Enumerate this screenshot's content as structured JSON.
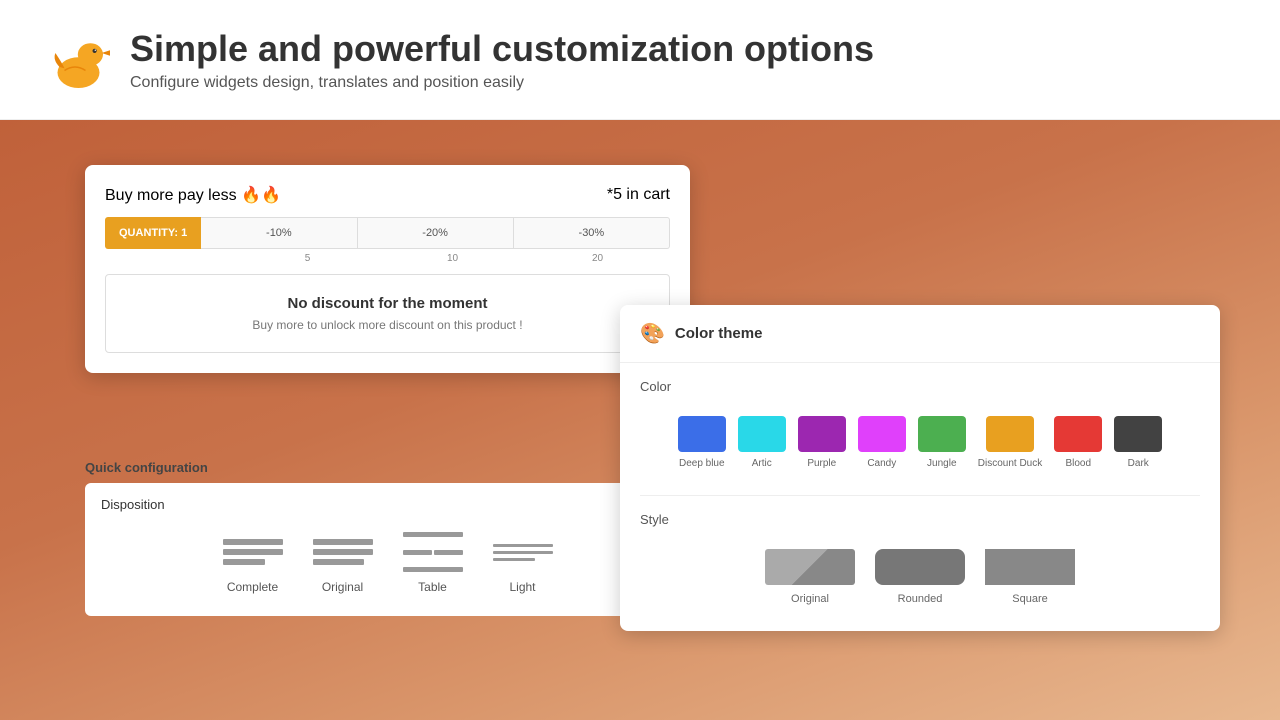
{
  "header": {
    "title": "Simple and powerful customization options",
    "subtitle": "Configure widgets design, translates and position easily",
    "logo_alt": "Duck logo"
  },
  "widget": {
    "buy_more_label": "Buy more pay less 🔥🔥",
    "in_cart_label": "*5 in cart",
    "quantity_label": "QUANTITY: 1",
    "segments": [
      "-10%",
      "-20%",
      "-30%"
    ],
    "numbers": [
      "5",
      "10",
      "20"
    ],
    "no_discount_title": "No discount for the moment",
    "no_discount_subtitle": "Buy more to unlock more discount on this product !"
  },
  "quick_config": {
    "label": "Quick configuration",
    "disposition": {
      "label": "Disposition",
      "options": [
        {
          "name": "Complete"
        },
        {
          "name": "Original"
        },
        {
          "name": "Table"
        },
        {
          "name": "Light"
        }
      ]
    }
  },
  "color_theme": {
    "panel_title": "Color theme",
    "color_section_label": "Color",
    "style_section_label": "Style",
    "colors": [
      {
        "name": "Deep blue",
        "hex": "#3b6ee8"
      },
      {
        "name": "Artic",
        "hex": "#29d8e8"
      },
      {
        "name": "Purple",
        "hex": "#9c27b0"
      },
      {
        "name": "Candy",
        "hex": "#e040fb"
      },
      {
        "name": "Jungle",
        "hex": "#4caf50"
      },
      {
        "name": "Discount Duck",
        "hex": "#e8a020"
      },
      {
        "name": "Blood",
        "hex": "#e53935"
      },
      {
        "name": "Dark",
        "hex": "#424242"
      }
    ],
    "styles": [
      {
        "name": "Original"
      },
      {
        "name": "Rounded"
      },
      {
        "name": "Square"
      }
    ]
  }
}
